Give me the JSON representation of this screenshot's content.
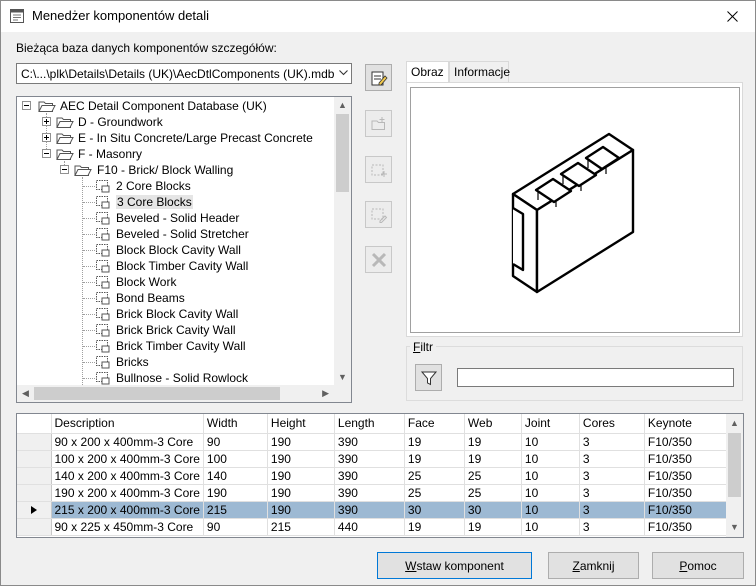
{
  "window": {
    "title": "Menedżer komponentów detali"
  },
  "database": {
    "label": "Bieżąca baza danych komponentów szczegółów:",
    "selected": "C:\\...\\plk\\Details\\Details (UK)\\AecDtlComponents (UK).mdb"
  },
  "tree": {
    "root": "AEC Detail Component Database (UK)",
    "folders": [
      "D - Groundwork",
      "E - In Situ Concrete/Large Precast Concrete",
      "F - Masonry"
    ],
    "subfolder": "F10 - Brick/ Block Walling",
    "items": [
      "2 Core Blocks",
      "3 Core Blocks",
      "Beveled - Solid Header",
      "Beveled - Solid Stretcher",
      "Block Block Cavity Wall",
      "Block Timber Cavity Wall",
      "Block Work",
      "Bond Beams",
      "Brick Block Cavity Wall",
      "Brick Brick Cavity Wall",
      "Brick Timber Cavity Wall",
      "Bricks",
      "Bullnose - Solid Rowlock"
    ]
  },
  "tabs": [
    {
      "label": "Obraz"
    },
    {
      "label": "Informacje"
    }
  ],
  "filter": {
    "label_prefix": "F",
    "label_rest": "iltr",
    "value": ""
  },
  "table": {
    "columns": [
      "Description",
      "Width",
      "Height",
      "Length",
      "Face",
      "Web",
      "Joint",
      "Cores",
      "Keynote"
    ],
    "rows": [
      [
        "90 x 200 x 400mm-3 Core",
        "90",
        "190",
        "390",
        "19",
        "19",
        "10",
        "3",
        "F10/350"
      ],
      [
        "100 x 200 x 400mm-3 Core",
        "100",
        "190",
        "390",
        "19",
        "19",
        "10",
        "3",
        "F10/350"
      ],
      [
        "140 x 200 x 400mm-3 Core",
        "140",
        "190",
        "390",
        "25",
        "25",
        "10",
        "3",
        "F10/350"
      ],
      [
        "190 x 200 x 400mm-3 Core",
        "190",
        "190",
        "390",
        "25",
        "25",
        "10",
        "3",
        "F10/350"
      ],
      [
        "215 x 200 x 400mm-3 Core",
        "215",
        "190",
        "390",
        "30",
        "30",
        "10",
        "3",
        "F10/350"
      ],
      [
        "90 x 225 x 450mm-3 Core",
        "90",
        "215",
        "440",
        "19",
        "19",
        "10",
        "3",
        "F10/350"
      ]
    ],
    "selected_row": 4
  },
  "buttons": {
    "insert_key": "W",
    "insert_rest": "staw komponent",
    "close_key": "Z",
    "close_rest": "amknij",
    "help_key": "P",
    "help_rest": "omoc"
  },
  "icons": {
    "app": "app-window-icon",
    "close": "close-icon",
    "tree_folder": "folder-icon",
    "tree_component": "component-icon",
    "filter": "filter-funnel-icon"
  },
  "colors": {
    "selection": "#9db9d3",
    "focus_border": "#0078d7"
  }
}
